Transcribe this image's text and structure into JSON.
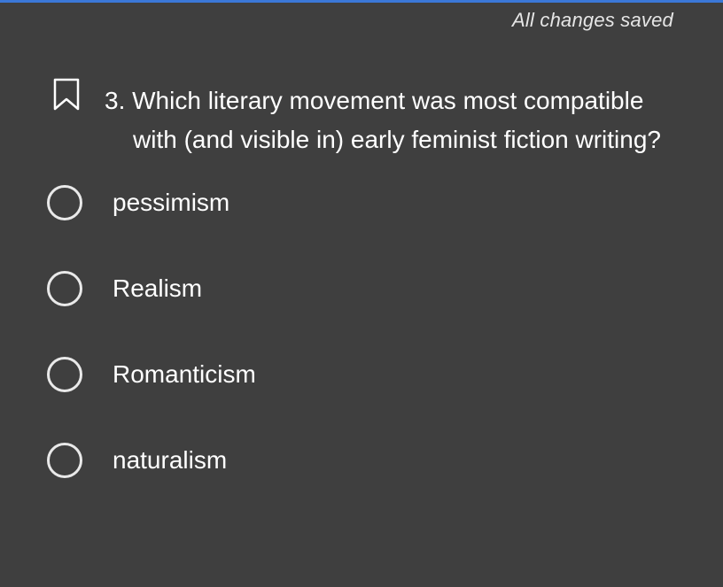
{
  "status": {
    "save_text": "All changes saved"
  },
  "question": {
    "number": "3.",
    "line1": "3. Which literary movement was most compatible",
    "line2": "with (and visible in) early feminist fiction writing?",
    "bookmark_icon": "bookmark-outline-icon"
  },
  "options": [
    {
      "label": "pessimism",
      "selected": false
    },
    {
      "label": "Realism",
      "selected": false
    },
    {
      "label": "Romanticism",
      "selected": false
    },
    {
      "label": "naturalism",
      "selected": false
    }
  ],
  "colors": {
    "background": "#3f3f3f",
    "accent_bar": "#3b78d8",
    "text": "#ffffff",
    "radio_border": "#e9e9e9"
  }
}
